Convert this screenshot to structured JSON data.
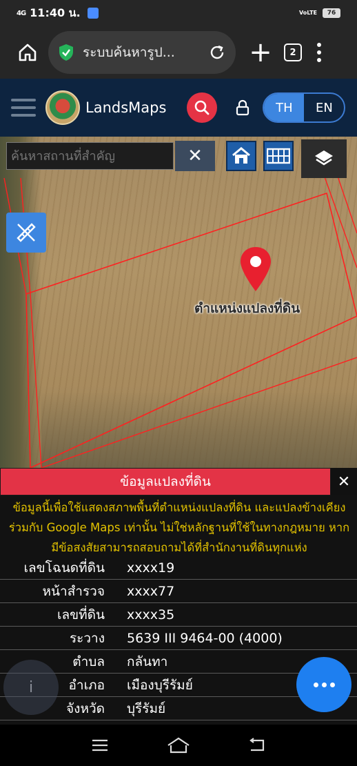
{
  "status_bar": {
    "signal": "4G",
    "time": "11:40 น.",
    "volte": "VoLTE",
    "battery": "76"
  },
  "browser": {
    "url_text": "ระบบค้นหารูป...",
    "tab_count": "2"
  },
  "header": {
    "brand": "LandsMaps",
    "lang_th": "TH",
    "lang_en": "EN"
  },
  "map": {
    "search_placeholder": "ค้นหาสถานที่สำคัญ",
    "clear_label": "✕",
    "pin_label": "ตำแหน่งแปลงที่ดิน"
  },
  "info": {
    "title": "ข้อมูลแปลงที่ดิน",
    "close_label": "✕",
    "disclaimer": "ข้อมูลนี้เพื่อใช้แสดงสภาพพื้นที่ตำแหน่งแปลงที่ดิน และแปลงข้างเคียงร่วมกับ Google Maps เท่านั้น ไม่ใช่หลักฐานที่ใช้ในทางกฎหมาย หากมีข้อสงสัยสามารถสอบถามได้ที่สำนักงานที่ดินทุกแห่ง",
    "rows": [
      {
        "label": "เลขโฉนดที่ดิน",
        "value": "xxxx19"
      },
      {
        "label": "หน้าสำรวจ",
        "value": "xxxx77"
      },
      {
        "label": "เลขที่ดิน",
        "value": "xxxx35"
      },
      {
        "label": "ระวาง",
        "value": "5639 III 9464-00 (4000)"
      },
      {
        "label": "ตำบล",
        "value": "กลันทา"
      },
      {
        "label": "อำเภอ",
        "value": "เมืองบุรีรัมย์"
      },
      {
        "label": "จังหวัด",
        "value": "บุรีรัมย์"
      }
    ]
  },
  "colors": {
    "header_bg": "#0d2440",
    "accent_red": "#e33346",
    "accent_blue": "#3d86e0",
    "disclaimer_text": "#e4c300"
  }
}
